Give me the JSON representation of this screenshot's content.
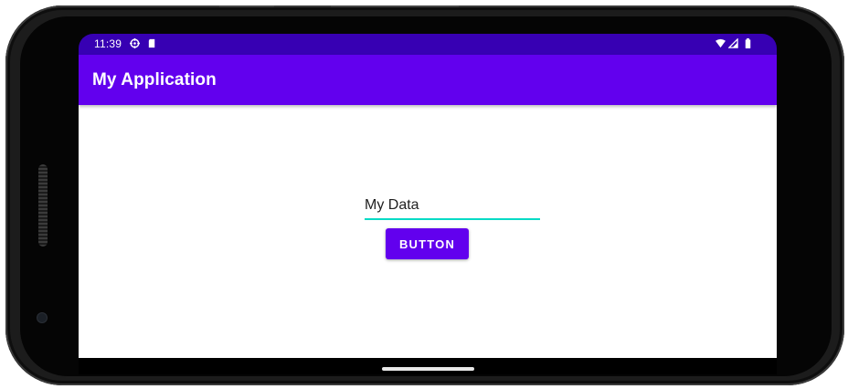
{
  "status_bar": {
    "time": "11:39",
    "left_icons": [
      "settings-sync-icon",
      "sd-card-icon"
    ],
    "right_icons": [
      "wifi-icon",
      "cell-signal-icon",
      "battery-icon"
    ]
  },
  "app_bar": {
    "title": "My Application"
  },
  "form": {
    "text_field_value": "My Data",
    "button_label": "BUTTON"
  },
  "colors": {
    "primary": "#6200ee",
    "primary_dark": "#3700b3",
    "accent": "#03dac5"
  }
}
